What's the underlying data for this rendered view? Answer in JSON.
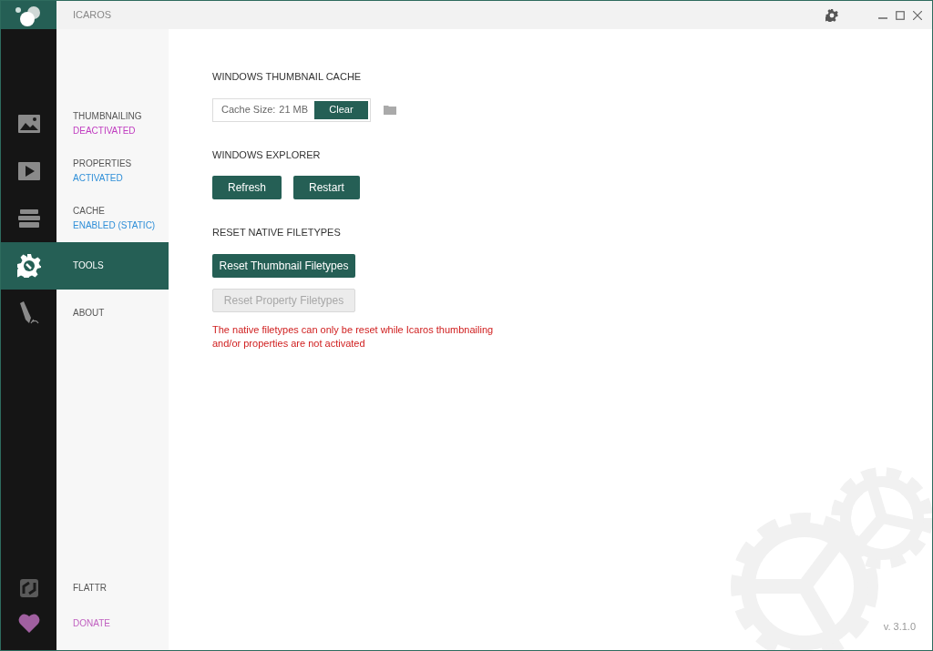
{
  "window": {
    "title": "ICAROS"
  },
  "nav": [
    {
      "label": "THUMBNAILING",
      "status": {
        "text": "DEACTIVATED",
        "color": "#c03cc0"
      },
      "kind": "image",
      "selected": false
    },
    {
      "label": "PROPERTIES",
      "status": {
        "text": "ACTIVATED",
        "color": "#2f8fd8"
      },
      "kind": "play",
      "selected": false
    },
    {
      "label": "CACHE",
      "status": {
        "text": "ENABLED (STATIC)",
        "color": "#2f8fd8"
      },
      "kind": "stack",
      "selected": false
    },
    {
      "label": "TOOLS",
      "kind": "gear",
      "selected": true
    },
    {
      "label": "ABOUT",
      "kind": "pen",
      "selected": false
    }
  ],
  "bottom_links": [
    {
      "label": "FLATTR",
      "kind": "flattr",
      "color": "#555555"
    },
    {
      "label": "DONATE",
      "kind": "heart",
      "color": "#c060c0"
    }
  ],
  "sections": [
    {
      "title": "WINDOWS THUMBNAIL CACHE",
      "kind": "cache",
      "cache_label": "Cache Size:",
      "cache_value": "21 MB",
      "buttons": [
        {
          "label": "Clear",
          "disabled": false
        }
      ]
    },
    {
      "title": "WINDOWS EXPLORER",
      "kind": "row",
      "buttons": [
        {
          "label": "Refresh",
          "disabled": false
        },
        {
          "label": "Restart",
          "disabled": false
        }
      ]
    },
    {
      "title": "RESET NATIVE FILETYPES",
      "kind": "column",
      "buttons": [
        {
          "label": "Reset Thumbnail Filetypes",
          "disabled": false
        },
        {
          "label": "Reset Property Filetypes",
          "disabled": true
        }
      ],
      "warning": "The native filetypes can only be reset while Icaros thumbnailing and/or properties are not activated"
    }
  ],
  "version": "v. 3.1.0"
}
